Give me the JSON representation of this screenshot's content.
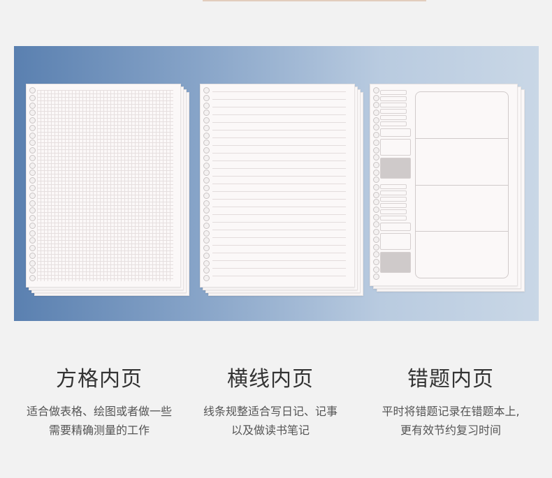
{
  "features": [
    {
      "title": "方格内页",
      "desc_line1": "适合做表格、绘图或者做一些",
      "desc_line2": "需要精确测量的工作"
    },
    {
      "title": "横线内页",
      "desc_line1": "线条规整适合写日记、记事",
      "desc_line2": "以及做读书笔记"
    },
    {
      "title": "错题内页",
      "desc_line1": "平时将错题记录在错题本上,",
      "desc_line2": "更有效节约复习时间"
    }
  ],
  "colors": {
    "background": "#f2f2f2",
    "banner_start": "#5a80b0",
    "banner_end": "#c9d7e6",
    "paper": "#fbf8f8"
  }
}
